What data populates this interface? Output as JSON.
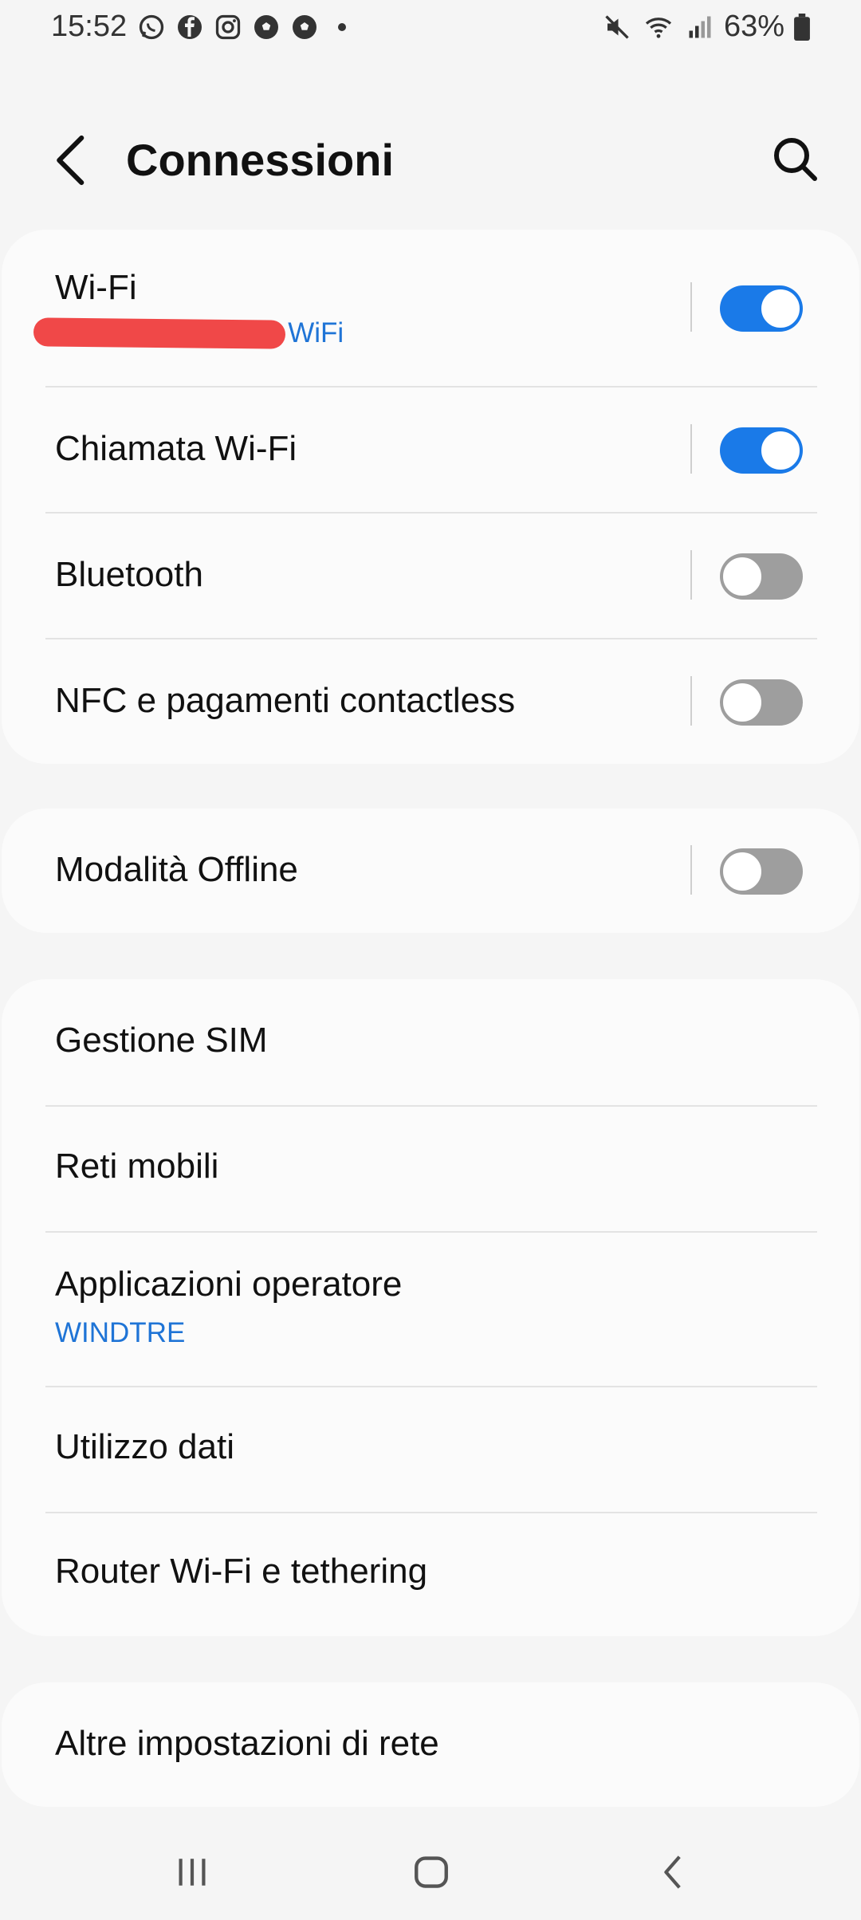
{
  "status_bar": {
    "time": "15:52",
    "notification_icons": [
      "whatsapp-icon",
      "facebook-icon",
      "instagram-icon",
      "soccer-ball-icon",
      "soccer-ball-icon"
    ],
    "battery_percent": "63%"
  },
  "header": {
    "title": "Connessioni"
  },
  "group1": {
    "wifi": {
      "label": "Wi-Fi",
      "sub": "a WiFi",
      "state": true
    },
    "wifi_calling": {
      "label": "Chiamata Wi-Fi",
      "state": true
    },
    "bluetooth": {
      "label": "Bluetooth",
      "state": false
    },
    "nfc": {
      "label": "NFC e pagamenti contactless",
      "state": false
    }
  },
  "group2": {
    "offline": {
      "label": "Modalità Offline",
      "state": false
    }
  },
  "group3": {
    "sim_manager": {
      "label": "Gestione SIM"
    },
    "mobile_networks": {
      "label": "Reti mobili"
    },
    "operator_apps": {
      "label": "Applicazioni operatore",
      "sub": "WINDTRE"
    },
    "data_usage": {
      "label": "Utilizzo dati"
    },
    "hotspot": {
      "label": "Router Wi-Fi e tethering"
    }
  },
  "group4": {
    "more_settings": {
      "label": "Altre impostazioni di rete"
    }
  },
  "colors": {
    "accent": "#1a7ae8",
    "toggle_off": "#9e9e9e",
    "background": "#f5f5f5",
    "card": "#fbfbfb"
  }
}
